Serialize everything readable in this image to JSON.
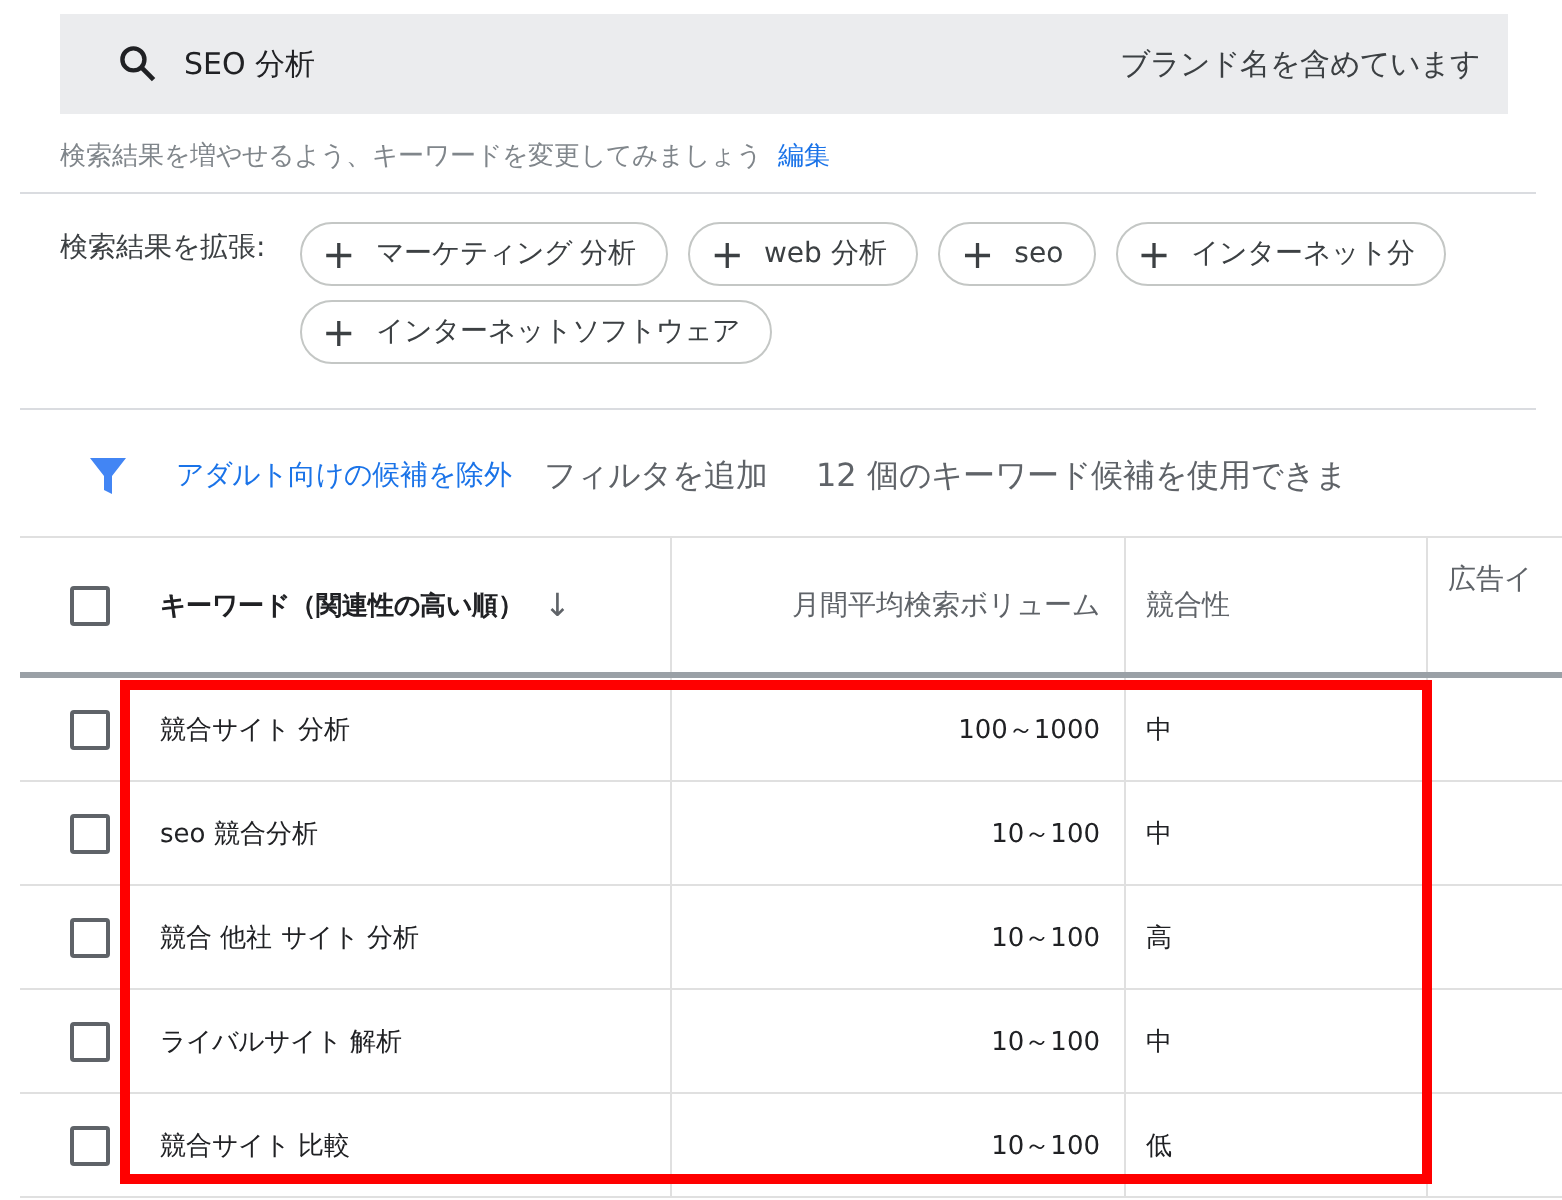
{
  "search": {
    "query": "SEO 分析",
    "brand_note": "ブランド名を含めています"
  },
  "hint": {
    "text": "検索結果を増やせるよう、キーワードを変更してみましょう",
    "link": "編集"
  },
  "expand": {
    "label": "検索結果を拡張:",
    "chips": [
      {
        "icon": "+",
        "label": "マーケティング 分析"
      },
      {
        "icon": "+",
        "label": "web 分析"
      },
      {
        "icon": "+",
        "label": "seo"
      },
      {
        "icon": "+",
        "label": "インターネット分"
      },
      {
        "icon": "+",
        "label": "インターネットソフトウェア"
      }
    ]
  },
  "filters": {
    "adult_filter": "アダルト向けの候補を除外",
    "add_filter": "フィルタを追加",
    "count_text": "12 個のキーワード候補を使用できま"
  },
  "table": {
    "header_checked": false,
    "sort_icon": "↓",
    "columns": [
      "キーワード（関連性の高い順）",
      "月間平均検索ボリューム",
      "競合性",
      "広告イ"
    ],
    "highlighted": true,
    "rows": [
      {
        "checked": false,
        "keyword": "競合サイト 分析",
        "volume": "100～1000",
        "competition": "中"
      },
      {
        "checked": false,
        "keyword": "seo 競合分析",
        "volume": "10～100",
        "competition": "中"
      },
      {
        "checked": false,
        "keyword": "競合 他社 サイト 分析",
        "volume": "10～100",
        "competition": "高"
      },
      {
        "checked": false,
        "keyword": "ライバルサイト 解析",
        "volume": "10～100",
        "competition": "中"
      },
      {
        "checked": false,
        "keyword": "競合サイト 比較",
        "volume": "10～100",
        "competition": "低"
      }
    ]
  }
}
